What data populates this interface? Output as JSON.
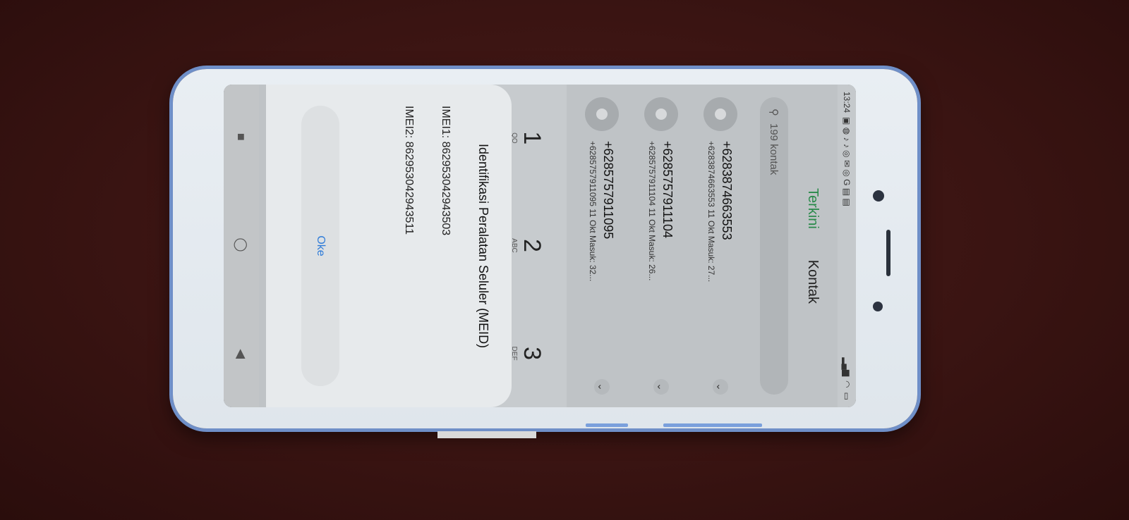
{
  "status_bar": {
    "time": "13:24",
    "right_icons": [
      "signal-icon",
      "wifi-icon",
      "battery-icon"
    ]
  },
  "header": {
    "tab_recent": "Terkini",
    "tab_contacts": "Kontak"
  },
  "search": {
    "placeholder": "199 kontak"
  },
  "calls": [
    {
      "number": "+6283874663553",
      "detail": "+6283874663553  11 Okt Masuk: 27..."
    },
    {
      "number": "+6285757911104",
      "detail": "+6285757911104  11 Okt Masuk: 26..."
    },
    {
      "number": "+6285757911095",
      "detail": "+6285757911095  11 Okt Masuk: 32..."
    }
  ],
  "keypad": [
    {
      "digit": "1",
      "letters": "QO"
    },
    {
      "digit": "2",
      "letters": "ABC"
    },
    {
      "digit": "3",
      "letters": "DEF"
    }
  ],
  "dialog": {
    "title": "Identifikasi Peralatan Seluler (MEID)",
    "imei1": "IMEI1: 862953042943503",
    "imei2": "IMEI2: 862953042943511",
    "ok_label": "Oke"
  },
  "colors": {
    "accent_green": "#2a8a4a",
    "link_blue": "#2e7bd8",
    "phone_frame": "#6f8fc8"
  }
}
